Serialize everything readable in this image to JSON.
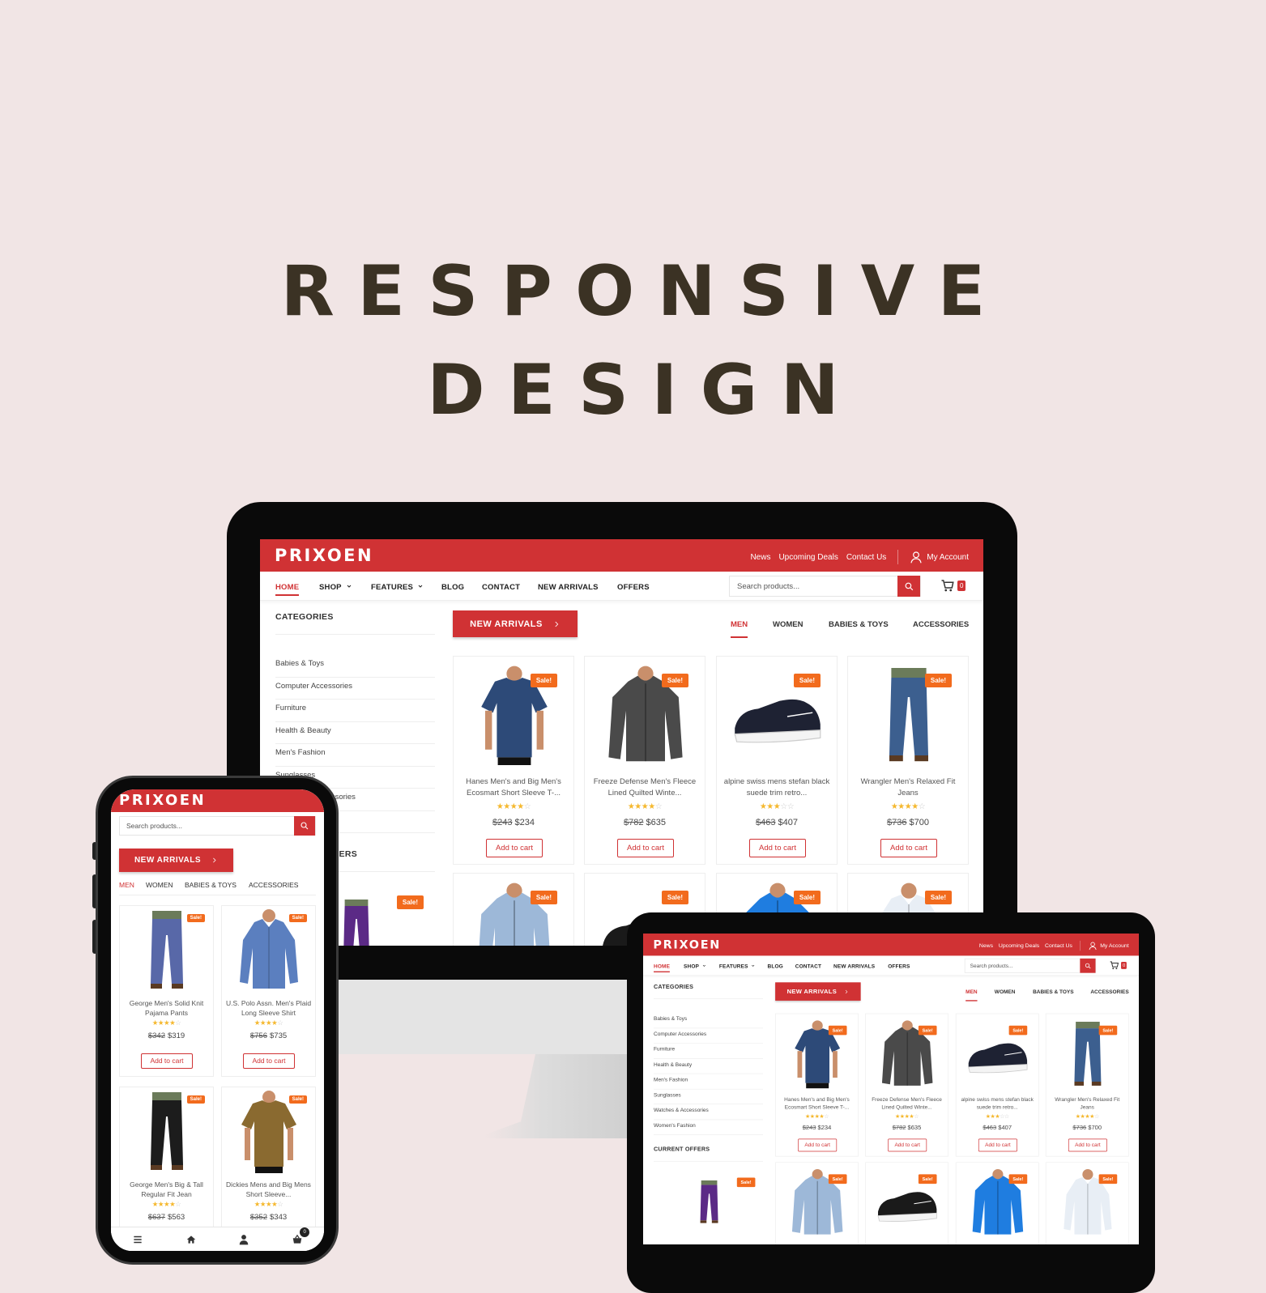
{
  "headline": {
    "line1": "RESPONSIVE",
    "line2": "DESIGN"
  },
  "colors": {
    "brand_red": "#d03234",
    "sale_orange": "#f26b1d",
    "star": "#f5b82e",
    "background": "#f1e5e5",
    "headline": "#3b3224"
  },
  "site": {
    "logo": "PRIXOEN",
    "top_links": [
      "News",
      "Upcoming Deals",
      "Contact Us"
    ],
    "account_label": "My Account",
    "nav": [
      {
        "label": "HOME",
        "active": true
      },
      {
        "label": "SHOP",
        "dropdown": true
      },
      {
        "label": "FEATURES",
        "dropdown": true
      },
      {
        "label": "BLOG"
      },
      {
        "label": "CONTACT"
      },
      {
        "label": "NEW ARRIVALS"
      },
      {
        "label": "OFFERS"
      }
    ],
    "search_placeholder": "Search products...",
    "cart_count": "0",
    "categories_title": "CATEGORIES",
    "categories": [
      "Babies & Toys",
      "Computer Accessories",
      "Furniture",
      "Health & Beauty",
      "Men's Fashion",
      "Sunglasses",
      "Watches & Accessories",
      "Women's Fashion"
    ],
    "current_offers_title": "CURRENT OFFERS",
    "offer_product": {
      "kind": "pants",
      "color": "#5b2a86",
      "sale": "Sale!"
    },
    "new_arrivals_label": "NEW ARRIVALS",
    "tabs": [
      {
        "label": "MEN",
        "active": true
      },
      {
        "label": "WOMEN"
      },
      {
        "label": "BABIES & TOYS"
      },
      {
        "label": "ACCESSORIES"
      }
    ],
    "sale_label": "Sale!",
    "add_to_cart": "Add to cart",
    "products": [
      {
        "name": "Hanes Men's and Big Men's Ecosmart Short Sleeve T-...",
        "old_price": "$243",
        "price": "$234",
        "rating": 3.5,
        "kind": "tshirt",
        "color": "#2d4a78"
      },
      {
        "name": "Freeze Defense Men's Fleece Lined Quilted Winte...",
        "old_price": "$782",
        "price": "$635",
        "rating": 3.5,
        "kind": "jacket",
        "color": "#4a4a4a"
      },
      {
        "name": "alpine swiss mens stefan black suede trim retro...",
        "old_price": "$463",
        "price": "$407",
        "rating": 3,
        "kind": "shoe",
        "color": "#1e2233"
      },
      {
        "name": "Wrangler Men's Relaxed Fit Jeans",
        "old_price": "$736",
        "price": "$700",
        "rating": 3.5,
        "kind": "pants",
        "color": "#3c5f8f"
      }
    ],
    "products_row2": [
      {
        "kind": "jacket",
        "color": "#9db8d8"
      },
      {
        "kind": "shoe",
        "color": "#1a1a1a"
      },
      {
        "kind": "jacket",
        "color": "#1f7de0"
      },
      {
        "kind": "shirt",
        "color": "#e8eef5"
      }
    ]
  },
  "mobile": {
    "products": [
      {
        "name": "George Men's Solid Knit Pajama Pants",
        "old_price": "$342",
        "price": "$319",
        "rating": 4,
        "kind": "pants",
        "color": "#5868a8"
      },
      {
        "name": "U.S. Polo Assn. Men's Plaid Long Sleeve Shirt",
        "old_price": "$756",
        "price": "$735",
        "rating": 4,
        "kind": "shirt",
        "color": "#5b7fbf"
      },
      {
        "name": "George Men's Big & Tall Regular Fit Jean",
        "old_price": "$637",
        "price": "$563",
        "rating": 4,
        "kind": "pants",
        "color": "#1c1c1c"
      },
      {
        "name": "Dickies Mens and Big Mens Short Sleeve...",
        "old_price": "$352",
        "price": "$343",
        "rating": 3.5,
        "kind": "tshirt",
        "color": "#8a6a30"
      }
    ],
    "bottom_bar": [
      "menu-icon",
      "home-icon",
      "user-icon",
      "cart-icon"
    ]
  }
}
